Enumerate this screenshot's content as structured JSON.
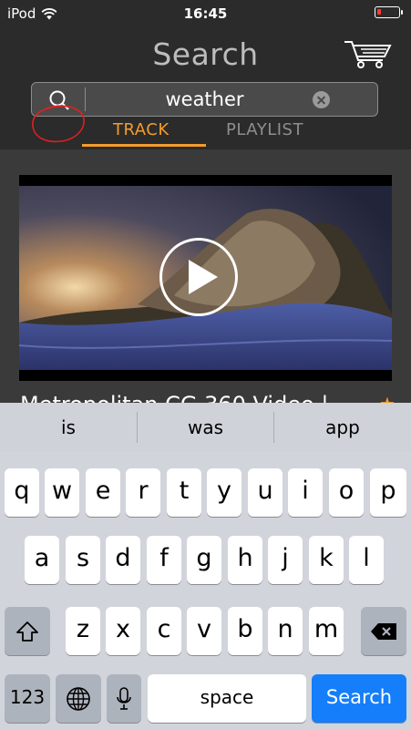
{
  "status": {
    "carrier": "iPod",
    "time": "16:45",
    "battery_color": "#ff3b30",
    "battery_level": 0.2
  },
  "header": {
    "title": "Search",
    "cart_icon": "shopping-cart-icon"
  },
  "search": {
    "value": "weather",
    "search_icon": "magnifier-icon",
    "clear_icon": "clear-icon"
  },
  "tabs": {
    "track": "TRACK",
    "playlist": "PLAYLIST",
    "active": "TRACK",
    "accent": "#f39c2d"
  },
  "result": {
    "title": "Metropolitan CG 360 Video |",
    "favorite_icon": "star-icon"
  },
  "keyboard": {
    "suggestions": [
      "is",
      "was",
      "app"
    ],
    "row1": [
      "q",
      "w",
      "e",
      "r",
      "t",
      "y",
      "u",
      "i",
      "o",
      "p"
    ],
    "row2": [
      "a",
      "s",
      "d",
      "f",
      "g",
      "h",
      "j",
      "k",
      "l"
    ],
    "row3": [
      "z",
      "x",
      "c",
      "v",
      "b",
      "n",
      "m"
    ],
    "numbers": "123",
    "space": "space",
    "search": "Search",
    "search_color": "#147efb"
  }
}
